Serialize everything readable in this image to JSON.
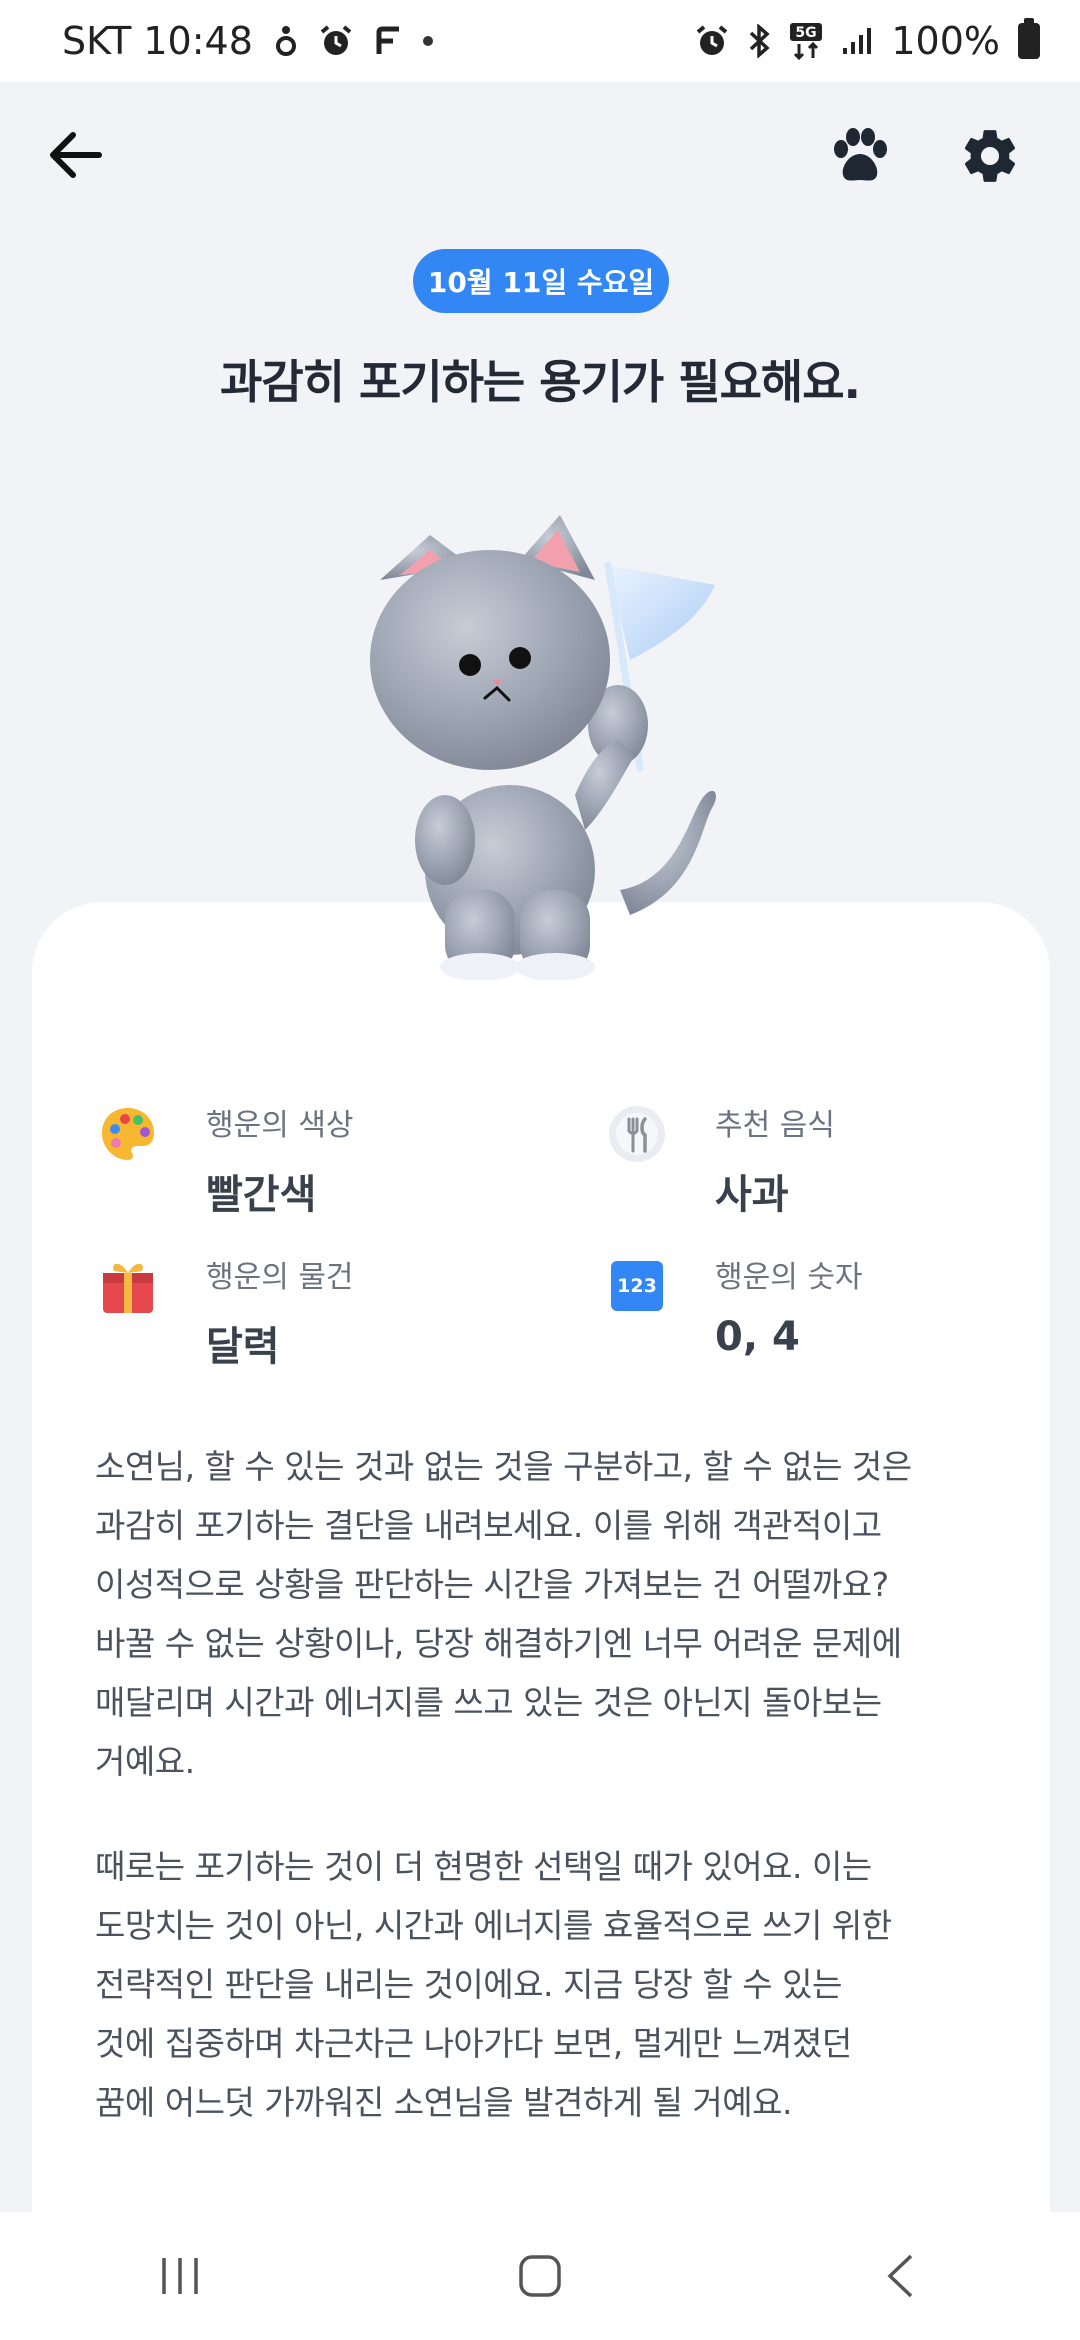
{
  "status_bar": {
    "carrier_time": "SKT 10:48",
    "battery_text": "100%",
    "network": "5G",
    "left_icons": [
      "fitness-icon",
      "alarm-icon",
      "app-f-icon",
      "dot-icon"
    ],
    "right_icons": [
      "alarm-icon",
      "bluetooth-icon",
      "5g-icon",
      "signal-icon",
      "battery-icon"
    ]
  },
  "appbar": {
    "icons": [
      "back-arrow-icon",
      "paw-icon",
      "gear-icon"
    ]
  },
  "date_badge": "10월 11일 수요일",
  "headline": "과감히 포기하는 용기가 필요해요.",
  "fortunes": [
    {
      "label": "행운의 색상",
      "value": "빨간색",
      "icon": "palette-icon"
    },
    {
      "label": "추천 음식",
      "value": "사과",
      "icon": "fork-knife-icon"
    },
    {
      "label": "행운의 물건",
      "value": "달력",
      "icon": "gift-icon"
    },
    {
      "label": "행운의 숫자",
      "value": "0, 4",
      "icon": "number-123-icon",
      "icon_text": "123"
    }
  ],
  "paragraphs": [
    {
      "lines": [
        "소연님, 할 수 있는 것과 없는 것을 구분하고, 할 수 없는 것은",
        "과감히 포기하는 결단을 내려보세요. 이를 위해 객관적이고",
        "이성적으로 상황을 판단하는 시간을 가져보는 건 어떨까요?",
        "바꿀 수 없는 상황이나, 당장 해결하기엔 너무 어려운 문제에",
        "매달리며 시간과 에너지를 쓰고 있는 것은 아닌지 돌아보는",
        "거예요."
      ]
    },
    {
      "lines": [
        "때로는 포기하는 것이 더 현명한 선택일 때가 있어요. 이는",
        "도망치는 것이 아닌, 시간과 에너지를 효율적으로 쓰기 위한",
        "전략적인 판단을 내리는 것이에요. 지금 당장 할 수 있는",
        "것에 집중하며 차근차근 나아가다 보면, 멀게만 느껴졌던",
        "꿈에 어느덧 가까워진 소연님을 발견하게 될 거예요."
      ]
    }
  ],
  "colors": {
    "accent": "#3387f5",
    "background": "#f1f3f6",
    "card": "#ffffff"
  },
  "navbar": {
    "icons": [
      "recent-apps-icon",
      "home-icon",
      "back-nav-icon"
    ]
  }
}
